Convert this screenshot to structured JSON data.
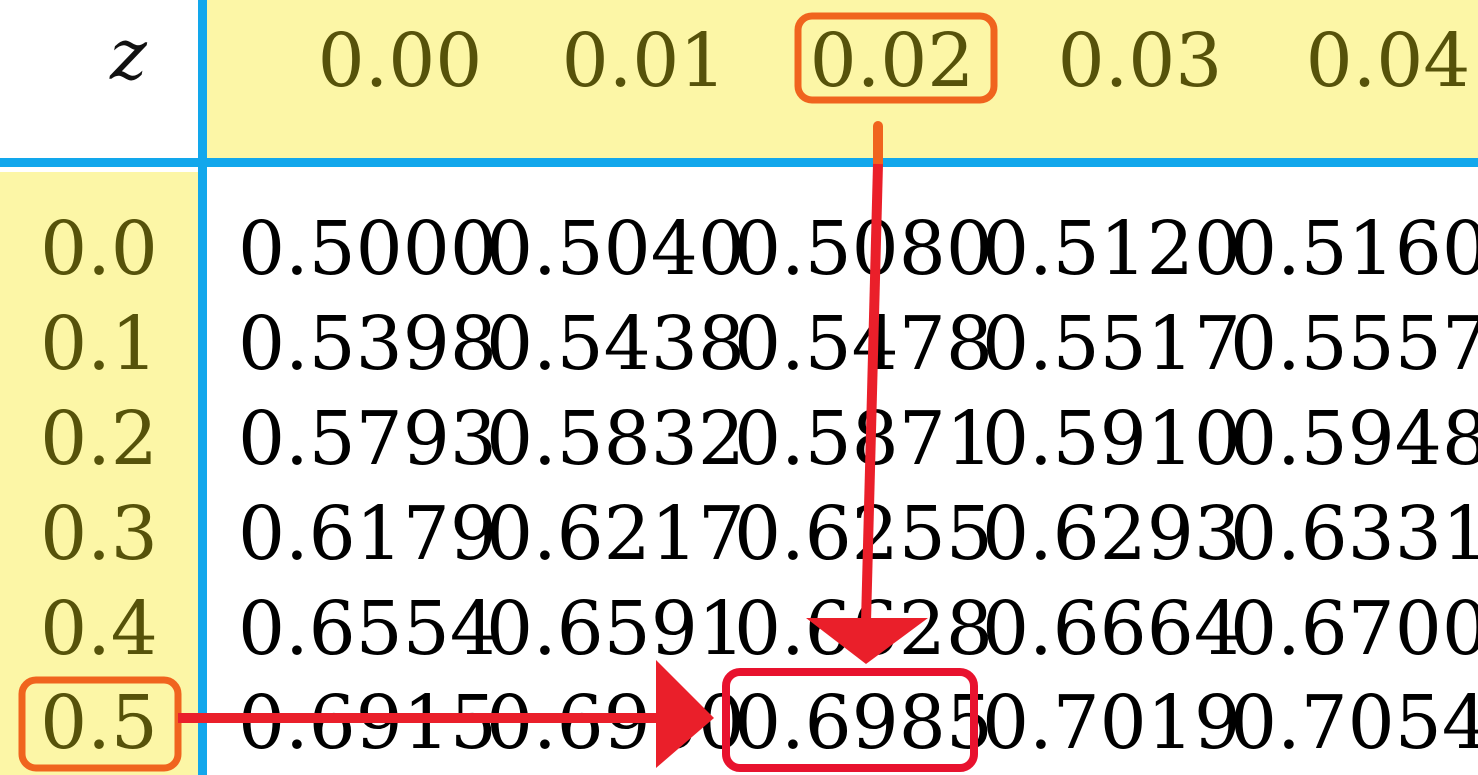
{
  "table": {
    "corner_label": "z",
    "columns": [
      "0.00",
      "0.01",
      "0.02",
      "0.03",
      "0.04"
    ],
    "rows": [
      {
        "z": "0.0",
        "values": [
          "0.5000",
          "0.5040",
          "0.5080",
          "0.5120",
          "0.5160"
        ]
      },
      {
        "z": "0.1",
        "values": [
          "0.5398",
          "0.5438",
          "0.5478",
          "0.5517",
          "0.5557"
        ]
      },
      {
        "z": "0.2",
        "values": [
          "0.5793",
          "0.5832",
          "0.5871",
          "0.5910",
          "0.5948"
        ]
      },
      {
        "z": "0.3",
        "values": [
          "0.6179",
          "0.6217",
          "0.6255",
          "0.6293",
          "0.6331"
        ]
      },
      {
        "z": "0.4",
        "values": [
          "0.6554",
          "0.6591",
          "0.6628",
          "0.6664",
          "0.6700"
        ]
      },
      {
        "z": "0.5",
        "values": [
          "0.6915",
          "0.6950",
          "0.6985",
          "0.7019",
          "0.7054"
        ]
      }
    ]
  },
  "highlight": {
    "column_label": "0.02",
    "row_label": "0.5",
    "result_value": "0.6985"
  },
  "colors": {
    "header_fill": "#fcf6a6",
    "grid_lines": "#12a7ec",
    "label_text": "#56520a",
    "label_box": "#f0641e",
    "arrow": "#ea1f2a",
    "result_box": "#e8122e"
  }
}
